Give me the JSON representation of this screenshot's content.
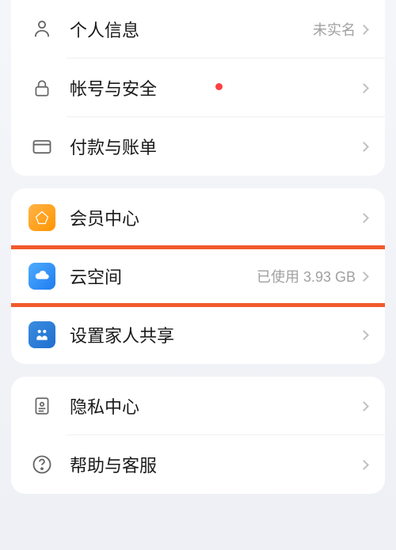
{
  "section1": {
    "personal_info": {
      "label": "个人信息",
      "value": "未实名"
    },
    "account_security": {
      "label": "帐号与安全"
    },
    "payment_billing": {
      "label": "付款与账单"
    }
  },
  "section2": {
    "member_center": {
      "label": "会员中心"
    },
    "cloud_space": {
      "label": "云空间",
      "value": "已使用 3.93 GB"
    },
    "family_sharing": {
      "label": "设置家人共享"
    }
  },
  "section3": {
    "privacy_center": {
      "label": "隐私中心"
    },
    "help_support": {
      "label": "帮助与客服"
    }
  }
}
